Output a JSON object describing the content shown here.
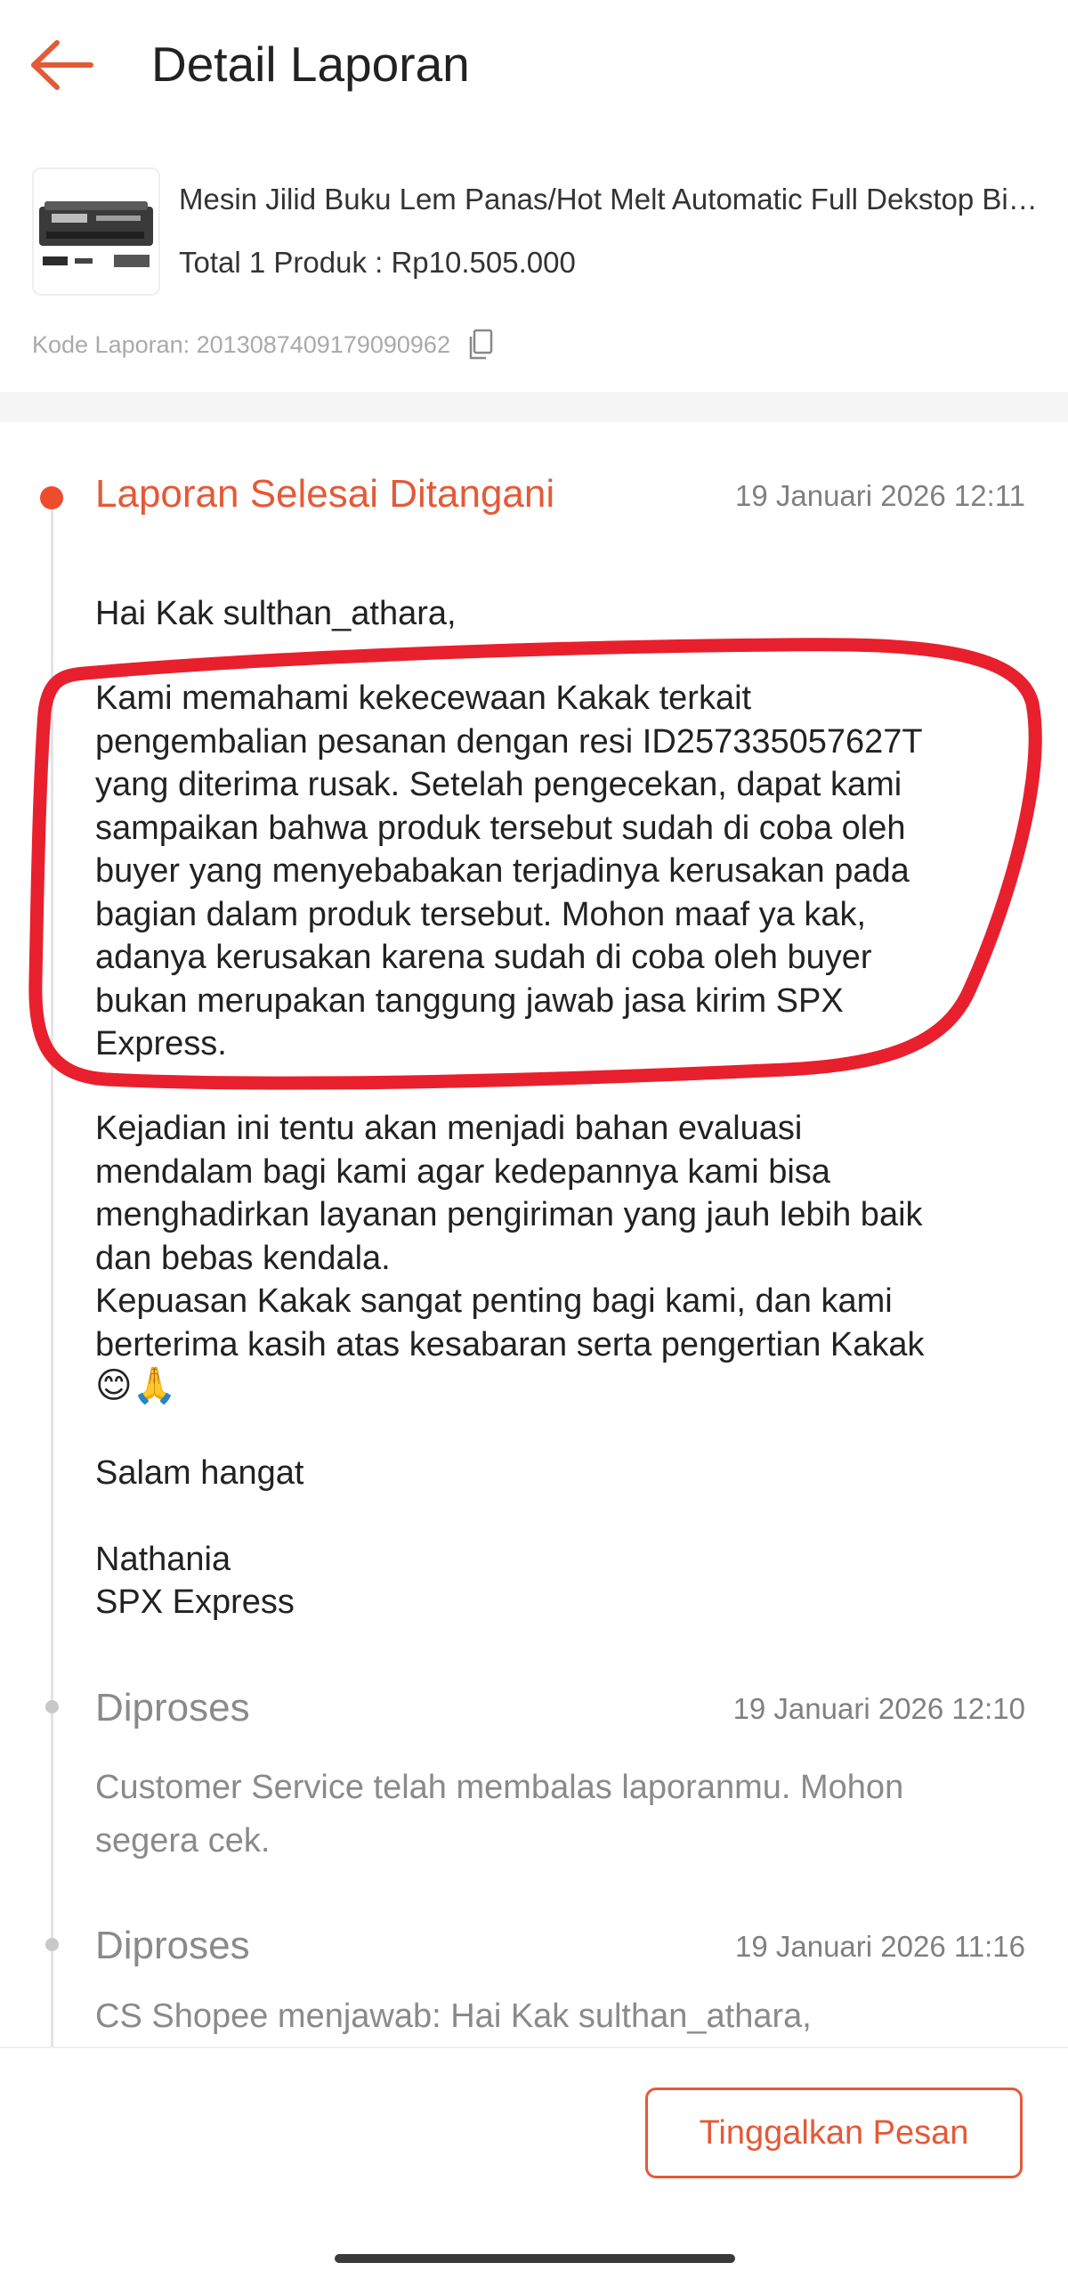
{
  "header": {
    "title": "Detail Laporan",
    "back_icon": "arrow-left-icon"
  },
  "product": {
    "name": "Mesin Jilid Buku Lem Panas/Hot Melt Automatic Full Dekstop Binding Machine",
    "total": "Total 1 Produk : Rp10.505.000",
    "report_code": "Kode Laporan: 2013087409179090962",
    "copy_icon": "copy-icon"
  },
  "timeline": [
    {
      "title": "Laporan Selesai Ditangani",
      "time": "19 Januari 2026 12:11",
      "greeting": "Hai Kak sulthan_athara,",
      "paragraph1": [
        "Kami memahami kekecewaan Kakak terkait",
        "pengembalian pesanan dengan resi ID257335057627T",
        "yang diterima rusak. Setelah pengecekan, dapat kami",
        "sampaikan bahwa produk tersebut sudah di coba oleh",
        "buyer yang menyebabakan terjadinya kerusakan pada",
        "bagian dalam produk tersebut. Mohon maaf ya kak,",
        "adanya kerusakan karena sudah di coba oleh buyer",
        "bukan merupakan tanggung jawab jasa kirim SPX",
        "Express."
      ],
      "paragraph2": [
        "Kejadian ini tentu akan menjadi bahan evaluasi",
        "mendalam bagi kami agar kedepannya kami bisa",
        "menghadirkan layanan pengiriman yang jauh lebih baik",
        "dan bebas kendala.",
        "Kepuasan Kakak sangat penting bagi kami, dan kami",
        "berterima kasih atas kesabaran serta pengertian Kakak"
      ],
      "emojis": "😊🙏",
      "closing": "Salam hangat",
      "signature_name": "Nathania",
      "signature_company": "SPX Express"
    },
    {
      "title": "Diproses",
      "time": "19 Januari 2026 12:10",
      "description": [
        "Customer Service telah membalas laporanmu. Mohon",
        "segera cek."
      ]
    },
    {
      "title": "Diproses",
      "time": "19 Januari 2026 11:16",
      "description": "CS Shopee menjawab: Hai Kak sulthan_athara,"
    }
  ],
  "bottom": {
    "leave_message_label": "Tinggalkan Pesan"
  },
  "colors": {
    "accent": "#ee4d2d",
    "status_active": "#e35a38",
    "highlight_mark": "#e8202d",
    "muted_text": "#8a8a8a"
  }
}
